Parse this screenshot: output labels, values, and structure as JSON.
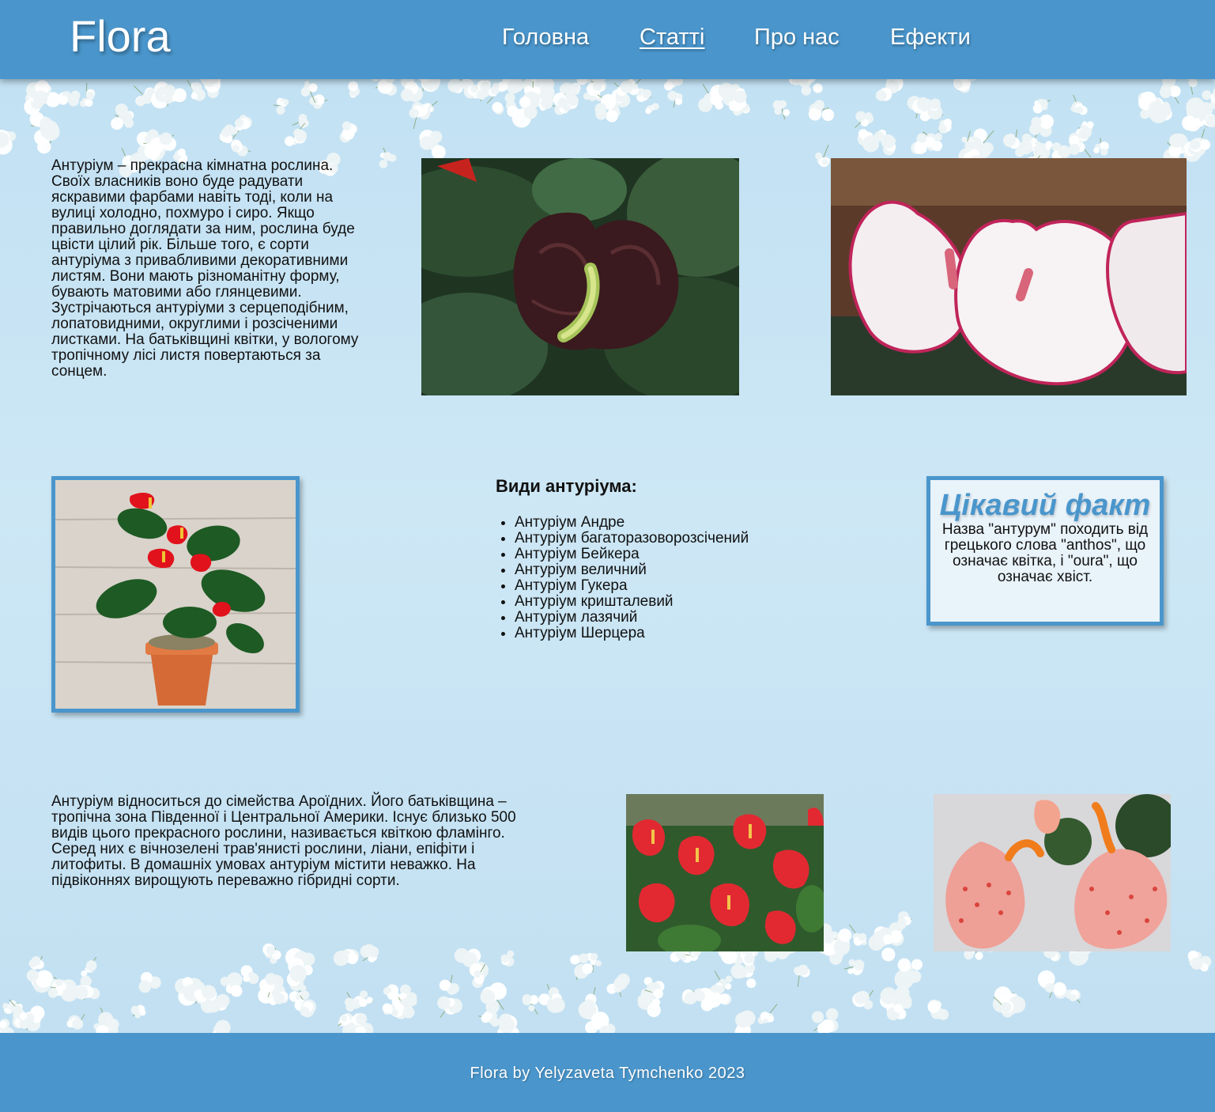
{
  "header": {
    "logo": "Flora",
    "nav": [
      {
        "label": "Головна"
      },
      {
        "label": "Статті"
      },
      {
        "label": "Про нас"
      },
      {
        "label": "Ефекти"
      }
    ]
  },
  "intro": {
    "text": "Антуріум – прекрасна кімнатна рослина. Своїх власників воно буде радувати яскравими фарбами навіть тоді, коли на вулиці холодно, похмуро і сиро. Якщо правильно доглядати за ним, рослина буде цвісти цілий рік. Більше того, є сорти антуріума з привабливими декоративними листям. Вони мають різноманітну форму, бувають матовими або глянцевими. Зустрічаються антуріуми з серцеподібним, лопатовидними, округлими і розсіченими листками. На батьківщині квітки, у вологому тропічному лісі листя повертаються за сонцем."
  },
  "types": {
    "title": "Види антуріума:",
    "items": [
      "Антуріум Андре",
      "Антуріум багаторазоворозсічений",
      "Антуріум Бейкера",
      "Антуріум величний",
      "Антуріум Гукера",
      "Антуріум кришталевий",
      "Антуріум лазячий",
      "Антуріум Шерцера"
    ]
  },
  "fact": {
    "title": "Цікавий факт",
    "text": "Назва \"антурум\" походить від грецького слова \"anthos\", що означає квітка, і \"oura\", що означає хвіст."
  },
  "family": {
    "text": "Антуріум відноситься до сімейства Ароїдних. Його батьківщина – тропічна зона Південної і Центральної Америки. Існує близько 500 видів цього прекрасного рослини, називається квіткою фламінго. Серед них є вічнозелені трав'янисті рослини, ліани, епіфіти і литофиты. В домашніх умовах антуріум містити неважко. На підвіконнях вирощують переважно гібридні сорти."
  },
  "footer": {
    "text": "Flora by Yelyzaveta Tymchenko 2023"
  },
  "colors": {
    "header_bg": "#4a96cc",
    "page_bg": "#c6e2f3",
    "accent": "#4a96cc"
  }
}
